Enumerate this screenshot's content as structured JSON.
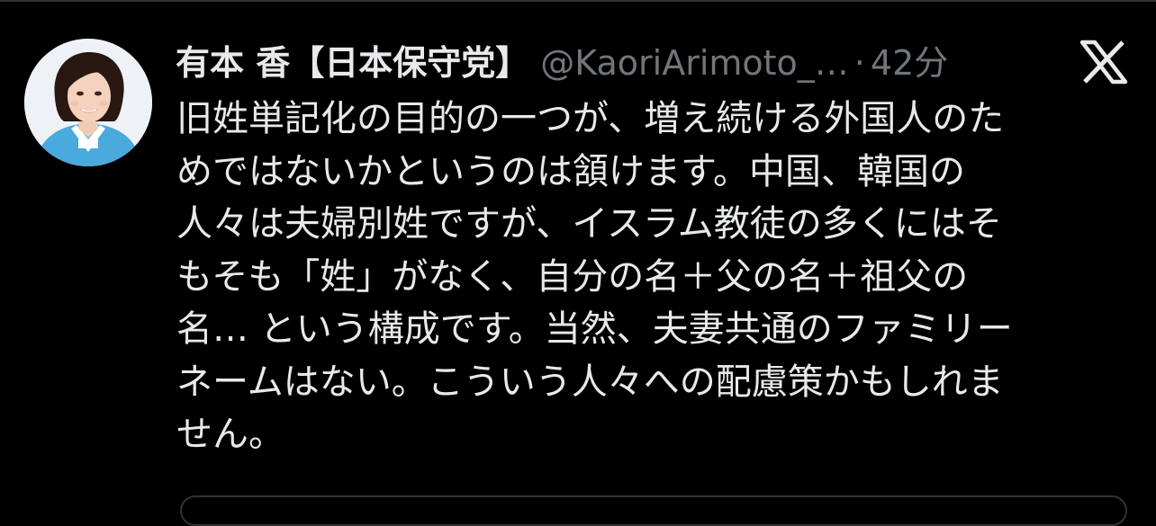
{
  "tweet": {
    "display_name": "有本 香【日本保守党】",
    "handle": "@KaoriArimoto_…",
    "separator": "·",
    "time": "42分",
    "text_lines": [
      "旧姓単記化の目的の一つが、増え続ける外国人のた",
      "めではないかというのは頷けます。中国、韓国の",
      "人々は夫婦別姓ですが、イスラム教徒の多くにはそ",
      "もそも「姓」がなく、自分の名＋父の名＋祖父の",
      "名… という構成です。当然、夫妻共通のファミリー",
      "ネームはない。こういう人々への配慮策かもしれま",
      "せん。"
    ]
  },
  "icons": {
    "avatar": "profile-photo",
    "platform": "x-logo"
  },
  "colors": {
    "background": "#000000",
    "text_primary": "#e7e9ea",
    "text_secondary": "#71767b",
    "divider": "#2f3336"
  }
}
